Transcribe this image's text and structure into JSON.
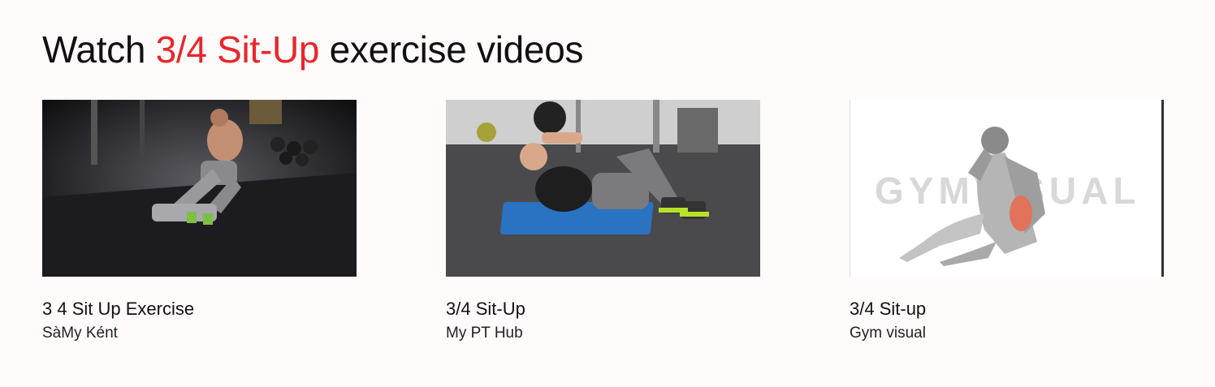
{
  "heading": {
    "prefix": "Watch ",
    "exercise": "3/4 Sit-Up",
    "suffix": " exercise videos"
  },
  "colors": {
    "accent": "#e8262b",
    "background": "#fffbfb"
  },
  "videos": [
    {
      "title": "3 4 Sit Up Exercise",
      "author": "SàMy Ként",
      "thumbnail": "dark-gym-situp-photo"
    },
    {
      "title": "3/4 Sit-Up",
      "author": "My PT Hub",
      "thumbnail": "gym-mat-situp-photo"
    },
    {
      "title": "3/4 Sit-up",
      "author": "Gym visual",
      "thumbnail": "anatomy-illustration",
      "watermark": "GYMVISUAL"
    }
  ]
}
